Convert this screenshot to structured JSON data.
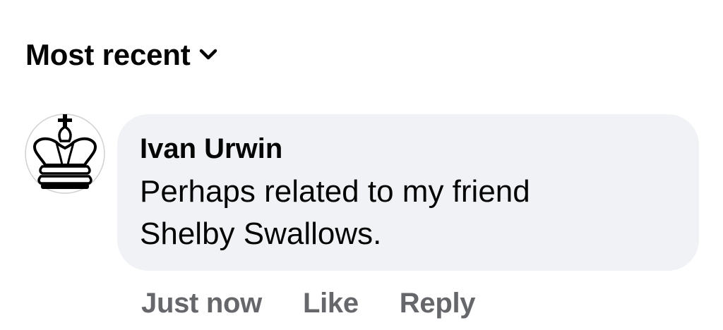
{
  "sort": {
    "label": "Most recent",
    "icon": "chevron-down-icon"
  },
  "comment": {
    "author": "Ivan Urwin",
    "text": "Perhaps related to my friend Shelby Swallows.",
    "avatar_icon": "crown-avatar-icon",
    "bubble_color": "#f0f2f5",
    "timestamp": "Just now",
    "like_label": "Like",
    "reply_label": "Reply",
    "action_color": "#65676b"
  }
}
